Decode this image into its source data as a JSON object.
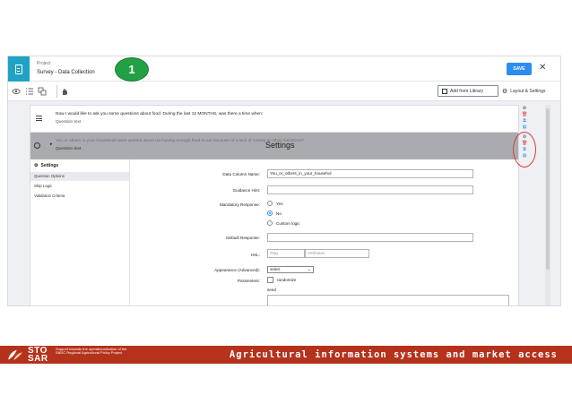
{
  "header": {
    "project_label": "Project",
    "project_name": "Survey - Data Collection",
    "step_number": "1",
    "save_label": "SAVE",
    "close_glyph": "✕"
  },
  "toolbar": {
    "add_from_library_label": "Add from Library",
    "layout_settings_label": "Layout & Settings",
    "icons": [
      "eye-icon",
      "list-icon",
      "copy-icon",
      "hand-icon"
    ]
  },
  "questions": [
    {
      "text": "Now I would like to ask you some questions about food. During the last 12 MONTHS, was there a time when:",
      "type": "Question text"
    },
    {
      "text": "You or others in your household were worried about not having enough food to eat because of a lack of money or other resources?",
      "type": "Question text"
    }
  ],
  "settings_panel": {
    "title": "Settings",
    "sidebar_heading": "Settings",
    "sidebar_items": [
      "Question Options",
      "Skip Logic",
      "Validation Criteria"
    ],
    "active_item": "Question Options",
    "fields": {
      "data_column_name_label": "Data Column Name:",
      "data_column_name_value": "You_or_others_in_your_househol",
      "guidance_hint_label": "Guidance Hint:",
      "mandatory_label": "Mandatory Response:",
      "mandatory_options": [
        "Yes",
        "No",
        "Custom logic"
      ],
      "mandatory_selected": "No",
      "default_response_label": "Default Response:",
      "hxl_label": "HXL:",
      "hxl_tag_placeholder": "#tag",
      "hxl_attributes_placeholder": "Attributes",
      "appearance_label": "Appearance (Advanced):",
      "appearance_value": "select",
      "parameters_label": "Parameters:",
      "randomize_label": "randomize",
      "seed_label": "seed"
    }
  },
  "footer": {
    "logo_text_top": "STO",
    "logo_text_bottom": "SAR",
    "logo_subtitle": "Support towards the operationalization of the SADC Regional Agricultural Policy Project",
    "tagline": "Agricultural information systems and market access"
  },
  "colors": {
    "accent": "#1fa2c4",
    "save": "#2d8cf0",
    "badge": "#21a045",
    "highlight_oval": "#e03a3a",
    "footer": "#b5321c"
  }
}
